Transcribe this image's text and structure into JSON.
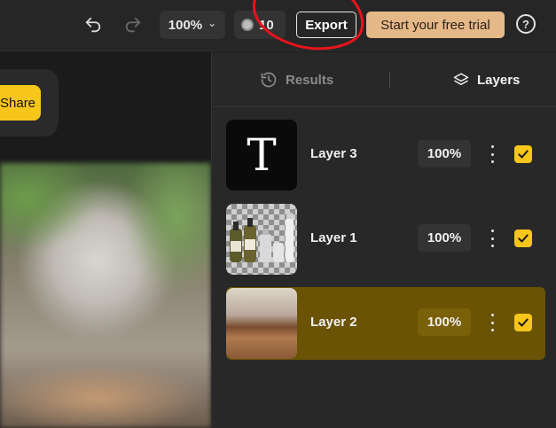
{
  "toolbar": {
    "undo_icon": "undo-icon",
    "redo_icon": "redo-icon",
    "zoom_value": "100%",
    "zoom_caret": "⌄",
    "credits_value": "10",
    "export_label": "Export",
    "trial_label": "Start your free trial",
    "help_label": "?"
  },
  "canvas": {
    "share_label": "Share"
  },
  "panel": {
    "tabs": [
      {
        "label": "Results",
        "icon": "history-icon",
        "active": false
      },
      {
        "label": "Layers",
        "icon": "layers-icon",
        "active": true
      }
    ],
    "layers": [
      {
        "name": "Layer 3",
        "opacity": "100%",
        "thumb_glyph": "T",
        "visible": true,
        "selected": false
      },
      {
        "name": "Layer 1",
        "opacity": "100%",
        "visible": true,
        "selected": false
      },
      {
        "name": "Layer 2",
        "opacity": "100%",
        "visible": true,
        "selected": true
      }
    ]
  },
  "colors": {
    "accent_yellow": "#f7c61a",
    "trial_button": "#e5b888",
    "selected_layer": "#6b5305",
    "annotation_red": "#e8141b"
  }
}
